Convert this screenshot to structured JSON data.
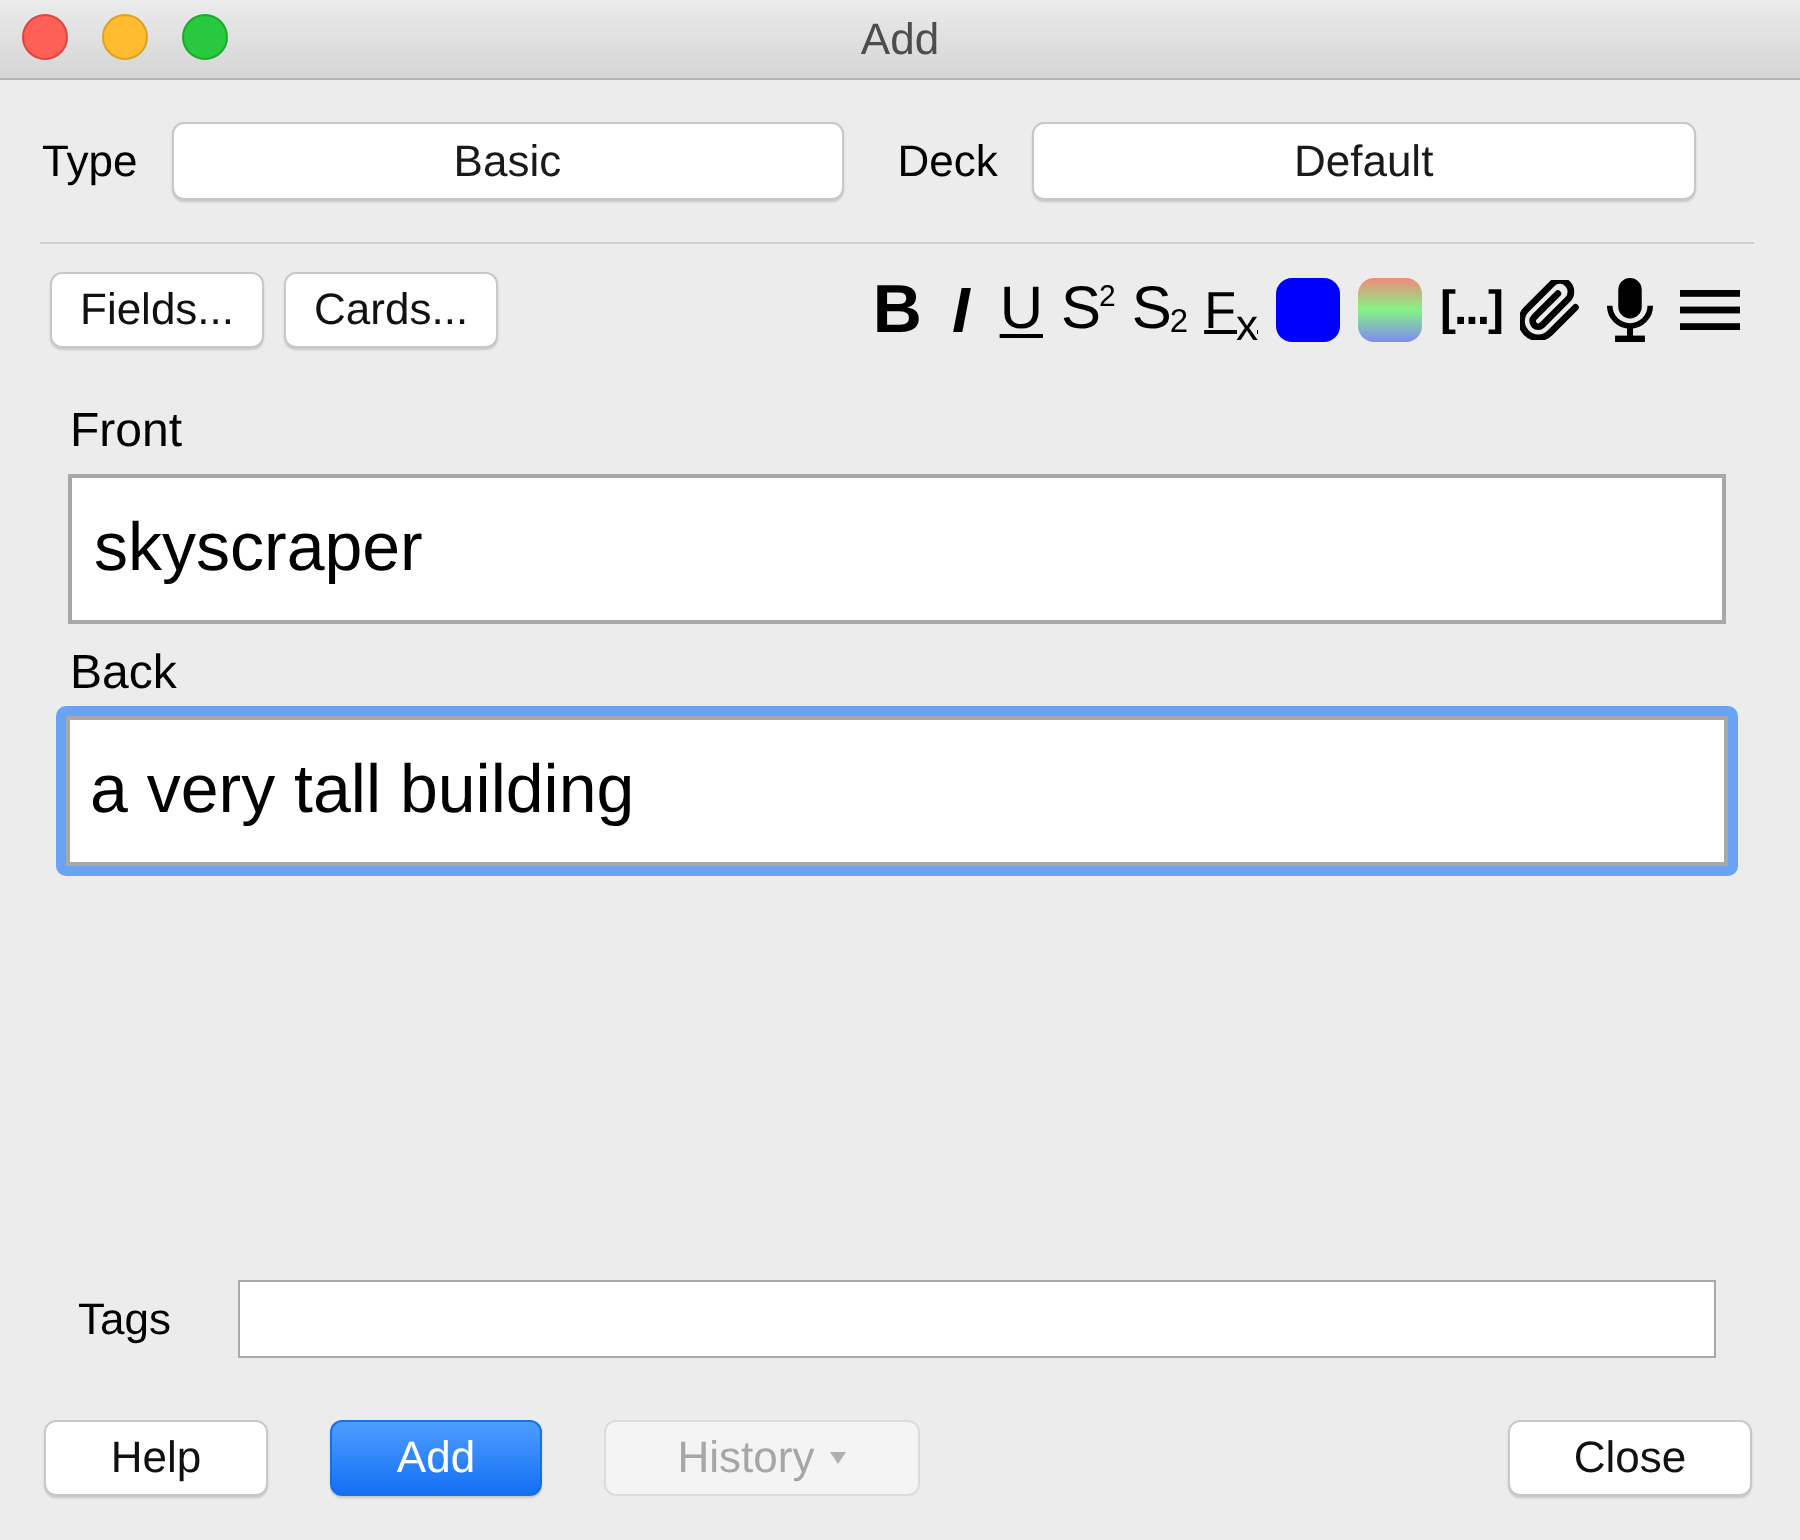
{
  "window": {
    "title": "Add"
  },
  "note_type": {
    "label": "Type",
    "value": "Basic"
  },
  "deck": {
    "label": "Deck",
    "value": "Default"
  },
  "editor_buttons": [
    {
      "label": "Fields..."
    },
    {
      "label": "Cards..."
    }
  ],
  "format_toolbar": [
    {
      "kind": "bold",
      "label": "B"
    },
    {
      "kind": "italic",
      "label": "I"
    },
    {
      "kind": "underline",
      "label": "U"
    },
    {
      "kind": "superscript",
      "label": "S$^{2}$"
    },
    {
      "kind": "subscript",
      "label": "S$_{2}$"
    },
    {
      "kind": "clear",
      "label": "F$_{x}$"
    },
    {
      "kind": "color",
      "color": "#0000ff"
    },
    {
      "kind": "picker"
    },
    {
      "kind": "cloze",
      "label": "[...]"
    },
    {
      "kind": "attach"
    },
    {
      "kind": "record"
    },
    {
      "kind": "more"
    }
  ],
  "fields": [
    {
      "label": "Front",
      "value": "skyscraper",
      "focused": false
    },
    {
      "label": "Back",
      "value": "a very tall building",
      "focused": true
    }
  ],
  "tags": {
    "label": "Tags"
  },
  "buttons": [
    {
      "label": "Help",
      "primary": false,
      "disabled": false,
      "dropdown": false
    },
    {
      "label": "Add",
      "primary": true,
      "disabled": false,
      "dropdown": false
    },
    {
      "label": "History",
      "primary": false,
      "disabled": true,
      "dropdown": true
    },
    {
      "label": "Close",
      "primary": false,
      "disabled": false,
      "dropdown": false
    }
  ]
}
